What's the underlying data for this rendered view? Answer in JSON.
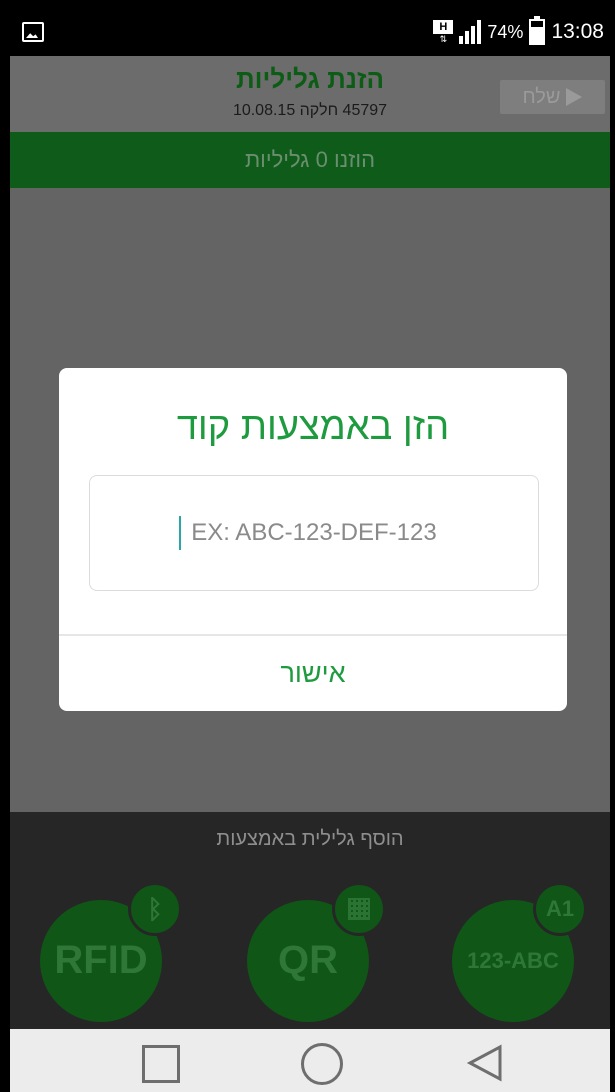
{
  "status_bar": {
    "h_indicator": "H",
    "h_arrows": "⇅",
    "battery_percent": "74%",
    "battery_level": 0.74,
    "time": "13:08"
  },
  "header": {
    "title": "הזנת גליליות",
    "subtitle": "45797 חלקה 10.08.15",
    "send_label": "שלח"
  },
  "entered_bar": {
    "text": "הוזנו 0 גליליות"
  },
  "dialog": {
    "title": "הזן באמצעות קוד",
    "input_placeholder": "EX: ABC-123-DEF-123",
    "input_value": "",
    "ok_label": "אישור"
  },
  "bottom_panel": {
    "label": "הוסף גלילית באמצעות",
    "buttons": [
      {
        "label": "RFID",
        "badge_icon": "bluetooth-icon"
      },
      {
        "label": "QR",
        "badge_icon": "qr-code-icon"
      },
      {
        "label": "123-ABC",
        "badge_text": "A1"
      }
    ]
  },
  "colors": {
    "brand_green": "#1e9a3f",
    "dark_green": "#0f5c1a",
    "overlay_gray": "#646464"
  }
}
